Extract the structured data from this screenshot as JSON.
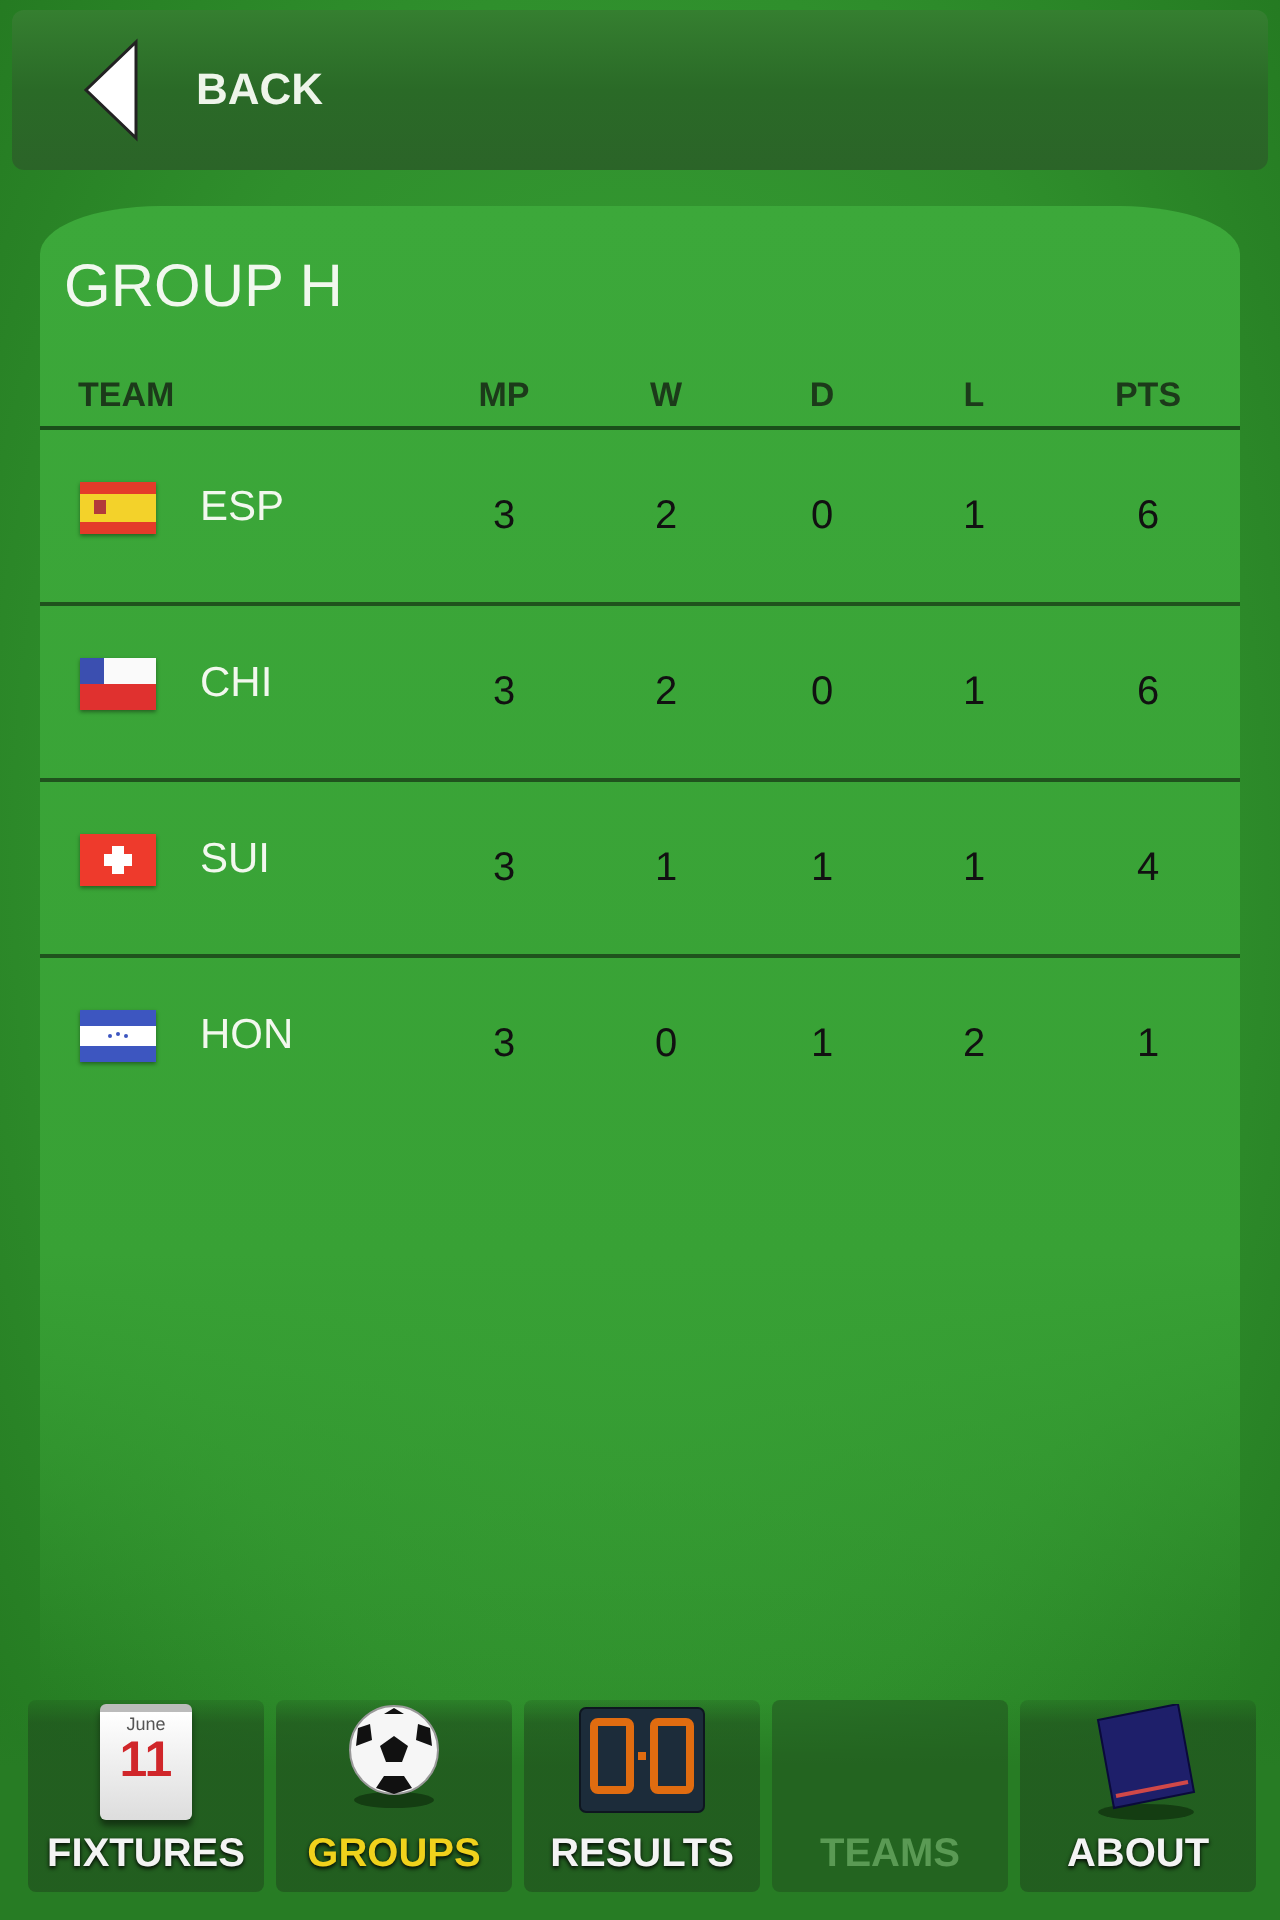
{
  "back_button": {
    "label": "BACK"
  },
  "group": {
    "title": "GROUP H",
    "columns": [
      "TEAM",
      "MP",
      "W",
      "D",
      "L",
      "PTS"
    ],
    "rows": [
      {
        "kind": "spain",
        "team": "ESP",
        "mp": "3",
        "w": "2",
        "d": "0",
        "l": "1",
        "pts": "6"
      },
      {
        "kind": "chile",
        "team": "CHI",
        "mp": "3",
        "w": "2",
        "d": "0",
        "l": "1",
        "pts": "6"
      },
      {
        "kind": "switzerland",
        "team": "SUI",
        "mp": "3",
        "w": "1",
        "d": "1",
        "l": "1",
        "pts": "4"
      },
      {
        "kind": "honduras",
        "team": "HON",
        "mp": "3",
        "w": "0",
        "d": "1",
        "l": "2",
        "pts": "1"
      }
    ]
  },
  "tab_bar": [
    {
      "kind": "calendar",
      "label": "FIXTURES",
      "selected": false,
      "disabled": false,
      "icon_month": "June",
      "icon_day": "11"
    },
    {
      "kind": "ball",
      "label": "GROUPS",
      "selected": true,
      "disabled": false
    },
    {
      "kind": "scoreboard",
      "label": "RESULTS",
      "selected": false,
      "disabled": false
    },
    {
      "kind": "none",
      "label": "TEAMS",
      "selected": false,
      "disabled": true
    },
    {
      "kind": "book",
      "label": "ABOUT",
      "selected": false,
      "disabled": false
    }
  ]
}
